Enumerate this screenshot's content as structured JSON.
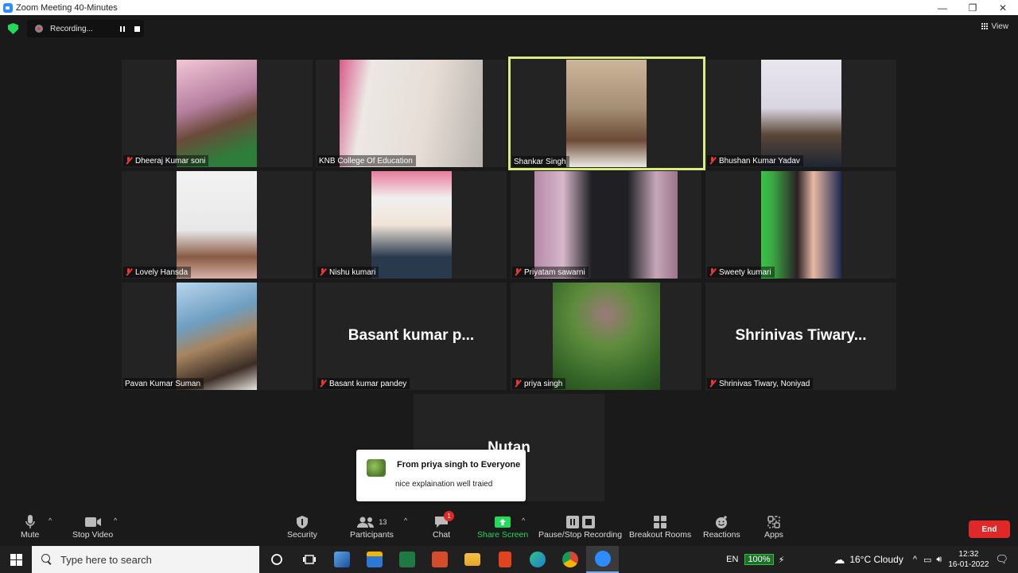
{
  "window": {
    "title": "Zoom Meeting 40-Minutes"
  },
  "meeting": {
    "recording_label": "Recording...",
    "view_label": "View",
    "participants": [
      {
        "name": "Dheeraj Kumar soni",
        "muted": true,
        "type": "video"
      },
      {
        "name": "KNB College Of Education",
        "muted": false,
        "type": "video"
      },
      {
        "name": "Shankar Singh",
        "muted": false,
        "type": "video",
        "active_speaker": true
      },
      {
        "name": "Bhushan Kumar Yadav",
        "muted": true,
        "type": "video"
      },
      {
        "name": "Lovely Hansda",
        "muted": true,
        "type": "video"
      },
      {
        "name": "Nishu kumari",
        "muted": true,
        "type": "video"
      },
      {
        "name": "Priyatam sawarni",
        "muted": true,
        "type": "video"
      },
      {
        "name": "Sweety kumari",
        "muted": true,
        "type": "video"
      },
      {
        "name": "Pavan Kumar Suman",
        "muted": false,
        "type": "video"
      },
      {
        "name": "Basant kumar pandey",
        "display_name": "Basant kumar p...",
        "muted": true,
        "type": "name-only"
      },
      {
        "name": "priya singh",
        "muted": true,
        "type": "video"
      },
      {
        "name": "Shrinivas Tiwary, Noniyad",
        "display_name": "Shrinivas Tiwary...",
        "muted": true,
        "type": "name-only"
      },
      {
        "display_name": "Nutan",
        "type": "name-only"
      }
    ],
    "chat_toast": {
      "from": "From priya singh to Everyone",
      "message": "nice explaination well traied"
    }
  },
  "toolbar": {
    "mute": "Mute",
    "stop_video": "Stop Video",
    "security": "Security",
    "participants": "Participants",
    "participants_count": "13",
    "chat": "Chat",
    "chat_badge": "1",
    "share_screen": "Share Screen",
    "recording": "Pause/Stop Recording",
    "breakout": "Breakout Rooms",
    "reactions": "Reactions",
    "apps": "Apps",
    "end": "End"
  },
  "taskbar": {
    "search_placeholder": "Type here to search",
    "language": "EN",
    "battery": "100%",
    "weather": "16°C  Cloudy",
    "time": "12:32",
    "date": "16-01-2022"
  },
  "colors": {
    "accent_green": "#23d959",
    "active_outline": "#d9ec7e",
    "end_red": "#e02828"
  }
}
